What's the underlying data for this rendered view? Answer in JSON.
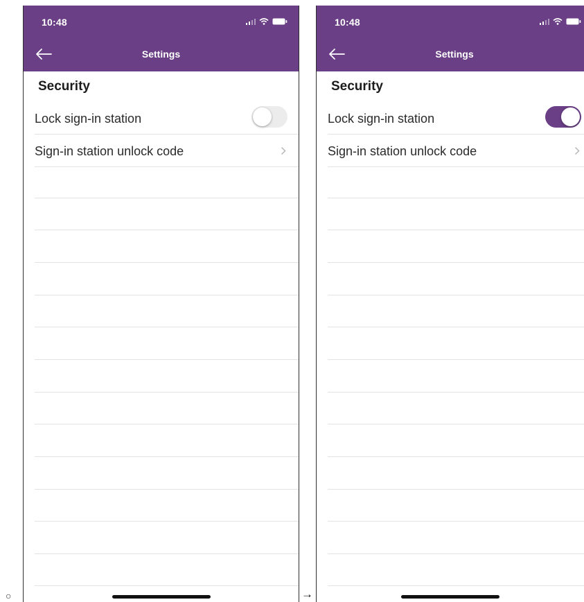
{
  "bullet": "○",
  "arrow": "→",
  "screens": [
    {
      "status_time": "10:48",
      "nav_title": "Settings",
      "section_title": "Security",
      "lock_label": "Lock sign-in station",
      "lock_toggle_on": false,
      "unlock_code_label": "Sign-in station unlock code"
    },
    {
      "status_time": "10:48",
      "nav_title": "Settings",
      "section_title": "Security",
      "lock_label": "Lock sign-in station",
      "lock_toggle_on": true,
      "unlock_code_label": "Sign-in station unlock code"
    }
  ],
  "colors": {
    "header_purple": "#6a3f86",
    "toggle_off": "#ececec",
    "divider": "#e3e3e3"
  },
  "icons": [
    "back-arrow-icon",
    "signal-icon",
    "wifi-icon",
    "battery-icon",
    "chevron-right-icon"
  ]
}
